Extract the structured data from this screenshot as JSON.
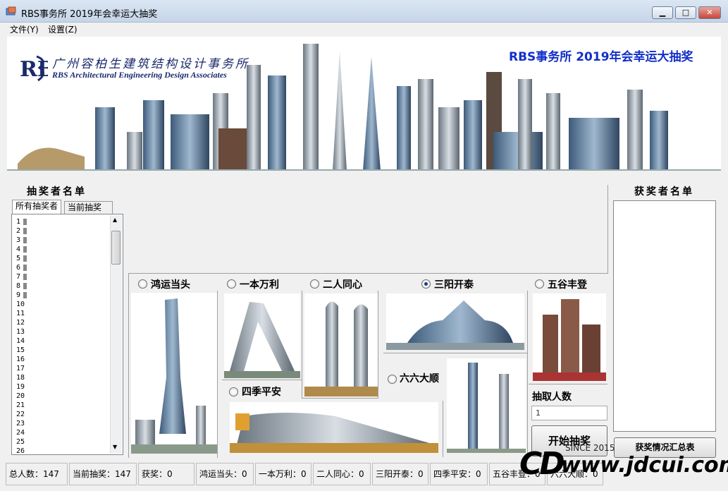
{
  "window": {
    "title": "RBS事务所 2019年会幸运大抽奖",
    "minimize": "▁",
    "maximize": "□",
    "close": "✕"
  },
  "menu": {
    "file": "文件(Y)",
    "settings": "设置(Z)"
  },
  "banner": {
    "company_cn": "广州容柏生建筑结构设计事务所",
    "company_en": "RBS Architectural Engineering Design Associates",
    "logo_text": "RBS",
    "event_title": "RBS事务所 2019年会幸运大抽奖",
    "colors": {
      "title": "#1230c8",
      "logo": "#1a2a6c"
    }
  },
  "participants": {
    "title": "抽奖者名单",
    "tabs": [
      "所有抽奖者",
      "当前抽奖者"
    ],
    "numbers": [
      "1",
      "2",
      "3",
      "4",
      "5",
      "6",
      "7",
      "8",
      "9",
      "10",
      "11",
      "12",
      "13",
      "14",
      "15",
      "16",
      "17",
      "18",
      "19",
      "20",
      "21",
      "22",
      "23",
      "24",
      "25",
      "26"
    ]
  },
  "winners": {
    "title": "获奖者名单",
    "summary_button": "获奖情况汇总表"
  },
  "prizes": [
    {
      "label": "鸿运当头",
      "selected": false
    },
    {
      "label": "一本万利",
      "selected": false
    },
    {
      "label": "二人同心",
      "selected": false
    },
    {
      "label": "三阳开泰",
      "selected": true
    },
    {
      "label": "五谷丰登",
      "selected": false
    },
    {
      "label": "四季平安",
      "selected": false
    },
    {
      "label": "六六大顺",
      "selected": false
    }
  ],
  "draw": {
    "count_label": "抽取人数",
    "count_value": "1",
    "start_button": "开始抽奖"
  },
  "status": {
    "total": "总人数：147",
    "current": "当前抽奖：147",
    "awarded": "获奖：0",
    "p1": "鸿运当头：0",
    "p2": "一本万利：0",
    "p3": "二人同心：0",
    "p4": "三阳开泰：0",
    "p5": "四季平安：0",
    "p6": "五谷丰登：0",
    "p7": "六六大顺：0"
  },
  "watermark": {
    "since": "SINCE 2015",
    "site": "www.jdcui.com",
    "mark": "CD"
  }
}
